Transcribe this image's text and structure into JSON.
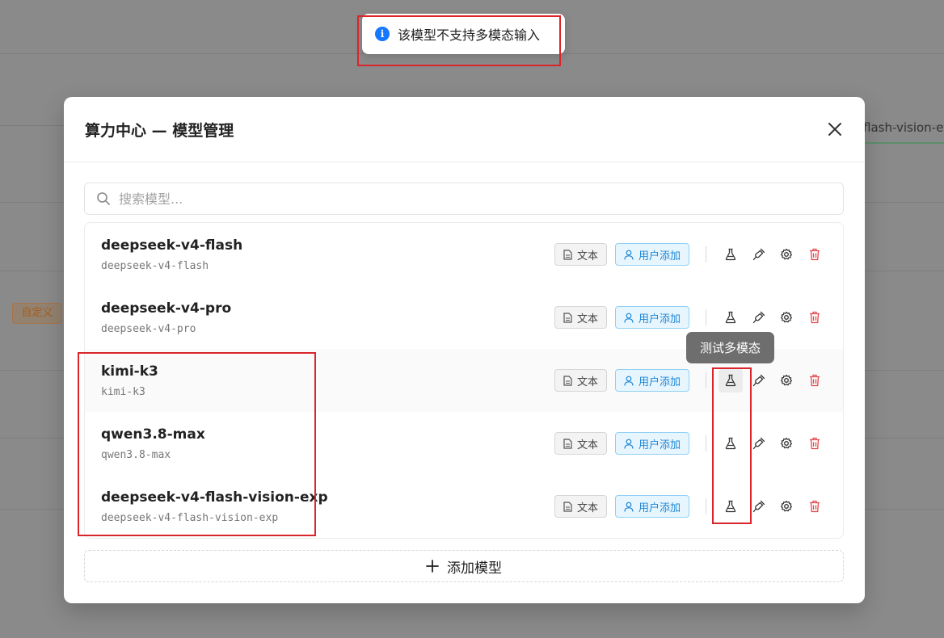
{
  "toast": {
    "message": "该模型不支持多模态输入",
    "icon": "info-icon",
    "color": "#1677ff"
  },
  "background": {
    "left_chip": "自定义",
    "right_chip": "flash-vision-e"
  },
  "modal": {
    "title": "算力中心 — 模型管理",
    "search_placeholder": "搜索模型...",
    "add_label": "添加模型",
    "models": [
      {
        "name": "deepseek-v4-flash",
        "id": "deepseek-v4-flash",
        "type_tag": "文本",
        "source_tag": "用户添加"
      },
      {
        "name": "deepseek-v4-pro",
        "id": "deepseek-v4-pro",
        "type_tag": "文本",
        "source_tag": "用户添加"
      },
      {
        "name": "kimi-k3",
        "id": "kimi-k3",
        "type_tag": "文本",
        "source_tag": "用户添加"
      },
      {
        "name": "qwen3.8-max",
        "id": "qwen3.8-max",
        "type_tag": "文本",
        "source_tag": "用户添加"
      },
      {
        "name": "deepseek-v4-flash-vision-exp",
        "id": "deepseek-v4-flash-vision-exp",
        "type_tag": "文本",
        "source_tag": "用户添加"
      }
    ]
  },
  "tooltip": {
    "text": "测试多模态"
  },
  "colors": {
    "delete": "#e5484d",
    "user_tag": "#1d86d6",
    "annotation": "#d9252b"
  }
}
